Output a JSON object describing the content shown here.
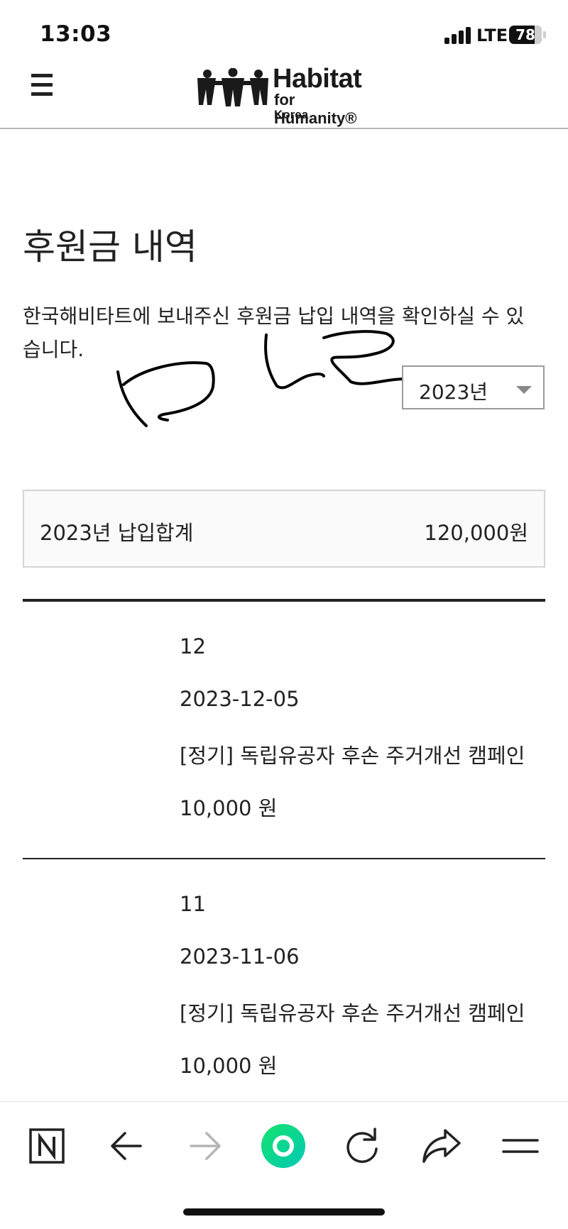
{
  "status_bar": {
    "time": "13:03",
    "network": "LTE",
    "battery_percent": "78",
    "battery_level": 0.78
  },
  "header": {
    "logo": {
      "line1": "Habitat",
      "line2": "for Humanity®",
      "line3": "Korea"
    },
    "menu_icon": "hamburger-icon"
  },
  "main": {
    "title": "후원금 내역",
    "description": "한국해비타트에 보내주신 후원금 납입 내역을 확인하실 수 있습니다.",
    "year_select": {
      "selected": "2023년",
      "icon": "dropdown-triangle-icon"
    },
    "summary": {
      "label": "2023년 납입합계",
      "value": "120,000원"
    },
    "records": [
      {
        "month": "12",
        "date": "2023-12-05",
        "campaign": "[정기] 독립유공자 후손 주거개선 캠페인",
        "amount": "10,000 원"
      },
      {
        "month": "11",
        "date": "2023-11-06",
        "campaign": "[정기] 독립유공자 후손 주거개선 캠페인",
        "amount": "10,000 원"
      }
    ]
  },
  "browser_toolbar": {
    "icons": [
      "naver-home-icon",
      "back-arrow-icon",
      "forward-arrow-icon",
      "green-circle-icon",
      "refresh-icon",
      "share-icon",
      "menu-icon"
    ],
    "accent_color": "#03de7a"
  }
}
